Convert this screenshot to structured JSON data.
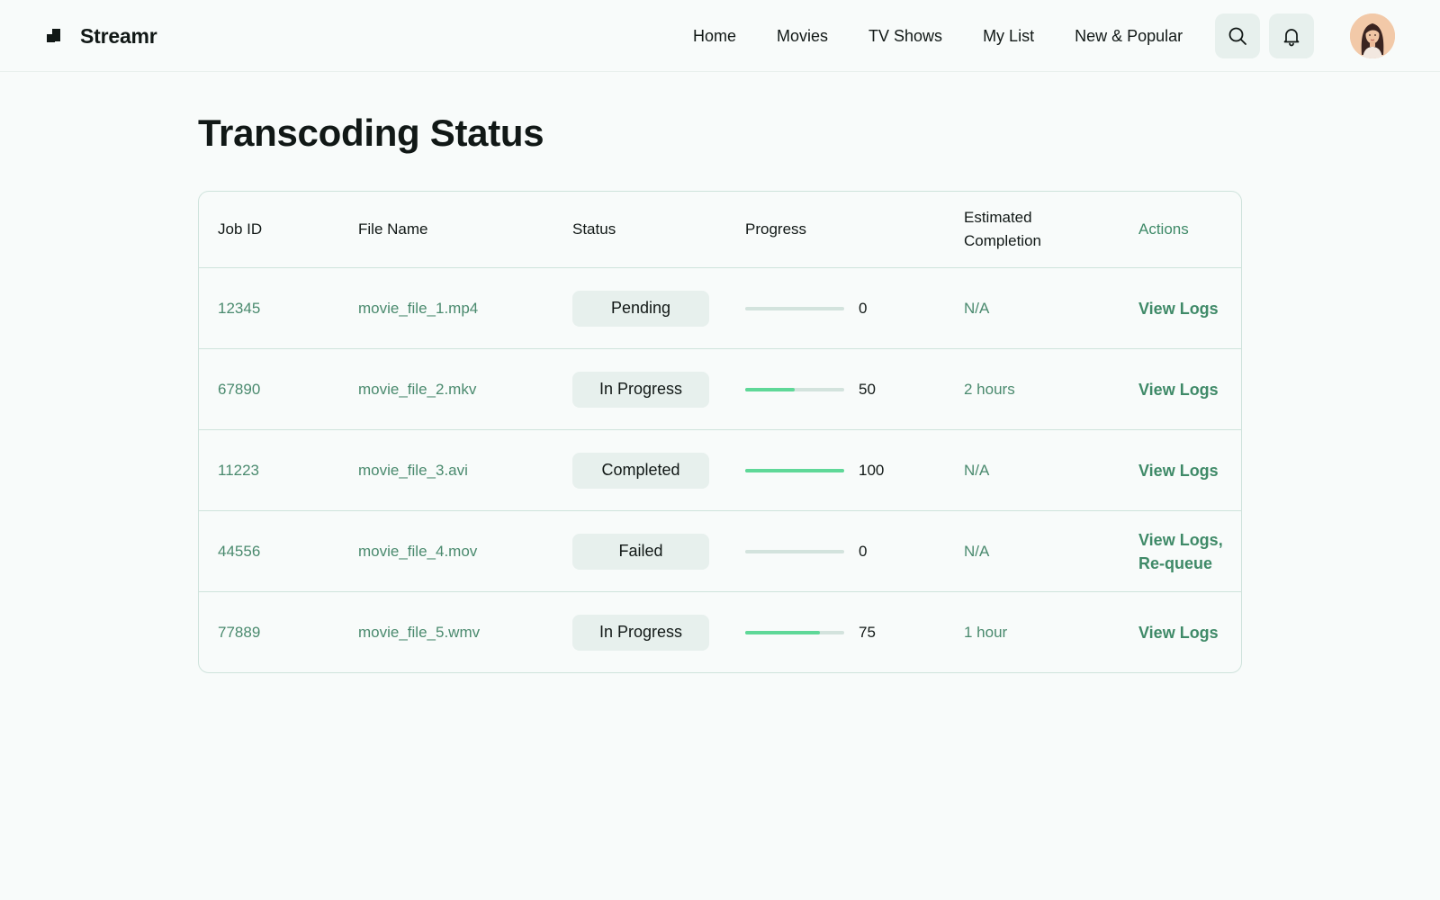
{
  "app": {
    "brand": "Streamr",
    "nav": [
      "Home",
      "Movies",
      "TV Shows",
      "My List",
      "New & Popular"
    ]
  },
  "icons": {
    "logo": "streamr-logo-icon",
    "search": "search-icon",
    "notifications": "bell-icon",
    "avatar": "user-avatar"
  },
  "colors": {
    "accent": "#3f8a68",
    "progress": "#5fd898",
    "pill": "#e7f0ed",
    "border": "#cfe3dc"
  },
  "page": {
    "title": "Transcoding Status"
  },
  "table": {
    "headers": {
      "job_id": "Job ID",
      "file_name": "File Name",
      "status": "Status",
      "progress": "Progress",
      "eta_line1": "Estimated",
      "eta_line2": "Completion",
      "actions": "Actions"
    },
    "rows": [
      {
        "job_id": "12345",
        "file_name": "movie_file_1.mp4",
        "status": "Pending",
        "progress": 0,
        "progress_text": "0",
        "eta": "N/A",
        "actions": [
          "View Logs"
        ]
      },
      {
        "job_id": "67890",
        "file_name": "movie_file_2.mkv",
        "status": "In Progress",
        "progress": 50,
        "progress_text": "50",
        "eta": "2 hours",
        "actions": [
          "View Logs"
        ]
      },
      {
        "job_id": "11223",
        "file_name": "movie_file_3.avi",
        "status": "Completed",
        "progress": 100,
        "progress_text": "100",
        "eta": "N/A",
        "actions": [
          "View Logs"
        ]
      },
      {
        "job_id": "44556",
        "file_name": "movie_file_4.mov",
        "status": "Failed",
        "progress": 0,
        "progress_text": "0",
        "eta": "N/A",
        "actions": [
          "View Logs,",
          "Re-queue"
        ]
      },
      {
        "job_id": "77889",
        "file_name": "movie_file_5.wmv",
        "status": "In Progress",
        "progress": 75,
        "progress_text": "75",
        "eta": "1 hour",
        "actions": [
          "View Logs"
        ]
      }
    ]
  }
}
